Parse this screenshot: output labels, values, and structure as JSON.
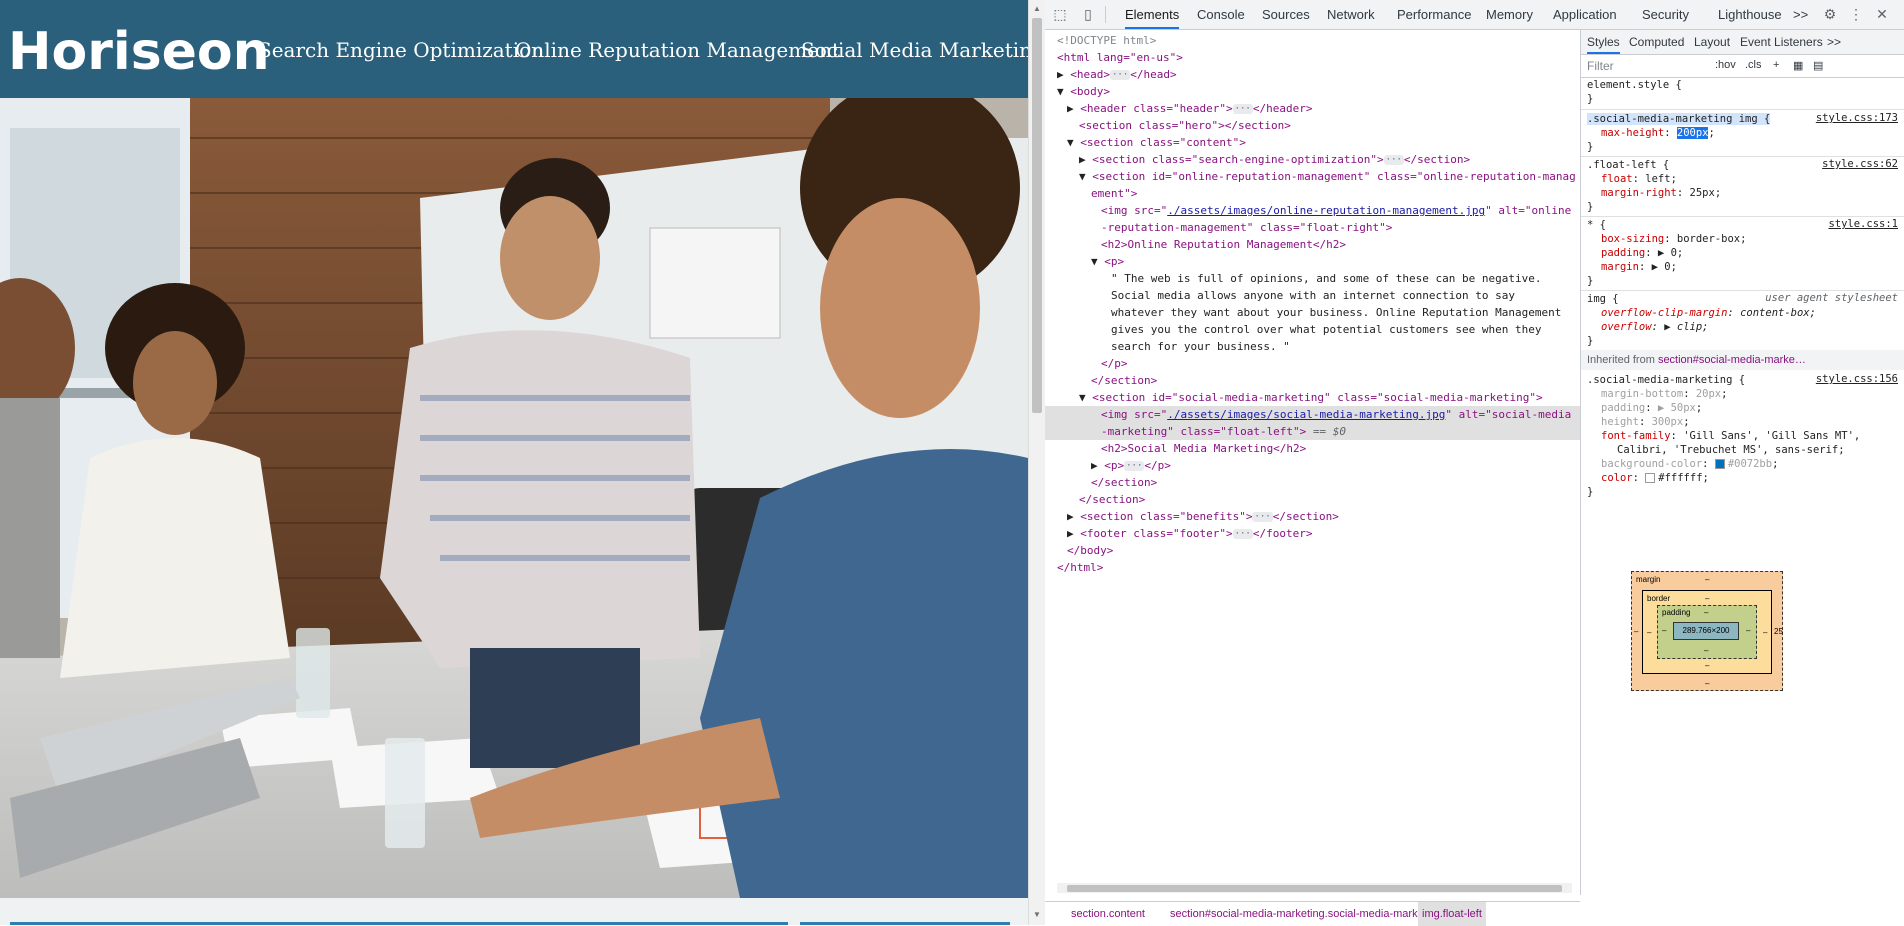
{
  "site": {
    "logo": "Horiseon",
    "nav": [
      "Search Engine Optimization",
      "Online Reputation Management",
      "Social Media Marketing"
    ]
  },
  "devtools": {
    "tabs": [
      "Elements",
      "Console",
      "Sources",
      "Network",
      "Performance",
      "Memory",
      "Application",
      "Security",
      "Lighthouse"
    ],
    "active_tab": "Elements",
    "more": ">>",
    "dom": {
      "doctype": "<!DOCTYPE html>",
      "html_open": "<html lang=\"en-us\">",
      "head": "<head>",
      "head_close": "</head>",
      "body_open": "<body>",
      "header": "<header class=\"header\">",
      "header_close": "</header>",
      "hero": "<section class=\"hero\"></section>",
      "content_open": "<section class=\"content\">",
      "seo": "<section class=\"search-engine-optimization\">",
      "section_close": "</section>",
      "orm_open_1": "<section id=\"online-reputation-management\" class=\"online-reputation-manag",
      "orm_open_2": "ement\">",
      "orm_img_tag": "<img src=\"",
      "orm_img_src": "./assets/images/online-reputation-management.jpg",
      "orm_img_alt_1": "\" alt=\"online",
      "orm_img_alt_2": "-reputation-management\" class=\"float-right\">",
      "orm_h2": "<h2>Online Reputation Management</h2>",
      "p_open": "<p>",
      "orm_text": [
        "\" The web is full of opinions, and some of these can be negative.",
        "Social media allows anyone with an internet connection to say",
        "whatever they want about your business. Online Reputation Management",
        "gives you the control over what potential customers see when they",
        "search for your business. \""
      ],
      "p_close": "</p>",
      "smm_open": "<section id=\"social-media-marketing\" class=\"social-media-marketing\">",
      "smm_img_tag": "<img src=\"",
      "smm_img_src": "./assets/images/social-media-marketing.jpg",
      "smm_img_alt_1": "\" alt=\"social-media",
      "smm_img_alt_2": "-marketing\" class=\"float-left\">",
      "smm_img_marker": "== $0",
      "smm_h2": "<h2>Social Media Marketing</h2>",
      "p_collapsed": "<p>",
      "p_collapsed_close": "</p>",
      "benefits": "<section class=\"benefits\">",
      "footer": "<footer class=\"footer\">",
      "footer_close": "</footer>",
      "body_close": "</body>",
      "html_close": "</html>",
      "dots": "···"
    },
    "breadcrumbs": [
      "section.content",
      "section#social-media-marketing.social-media-marketing",
      "img.float-left"
    ],
    "styles": {
      "sub_tabs": [
        "Styles",
        "Computed",
        "Layout",
        "Event Listeners",
        ">>"
      ],
      "filter_placeholder": "Filter",
      "hov": ":hov",
      "cls": ".cls",
      "plus": "+",
      "element_style": "element.style {",
      "close_brace": "}",
      "rule1_selector": ".social-media-marketing img {",
      "rule1_src": "style.css:173",
      "rule1_prop": "max-height",
      "rule1_val": "200px",
      "rule2_selector": ".float-left {",
      "rule2_src": "style.css:62",
      "rule2_props": [
        [
          "float",
          "left"
        ],
        [
          "margin-right",
          "25px"
        ]
      ],
      "rule3_selector": "* {",
      "rule3_src": "style.css:1",
      "rule3_props": [
        [
          "box-sizing",
          "border-box"
        ],
        [
          "padding",
          "▶ 0"
        ],
        [
          "margin",
          "▶ 0"
        ]
      ],
      "rule4_selector": "img {",
      "rule4_src": "user agent stylesheet",
      "rule4_props": [
        [
          "overflow-clip-margin",
          "content-box"
        ],
        [
          "overflow",
          "▶ clip"
        ]
      ],
      "inherited_label": "Inherited from",
      "inherited_from": "section#social-media-marke…",
      "rule5_selector": ".social-media-marketing {",
      "rule5_src": "style.css:156",
      "rule5_props": [
        [
          "margin-bottom",
          "20px"
        ],
        [
          "padding",
          "▶ 50px"
        ],
        [
          "height",
          "300px"
        ],
        [
          "font-family",
          "'Gill Sans', 'Gill Sans MT',"
        ],
        [
          "",
          "Calibri, 'Trebuchet MS', sans-serif"
        ],
        [
          "background-color",
          "#0072bb"
        ],
        [
          "color",
          "#ffffff"
        ]
      ],
      "bg_swatch": "#0072bb",
      "color_swatch": "#ffffff",
      "box": {
        "margin": "margin",
        "border": "border",
        "padding": "padding",
        "content": "289.766×200",
        "dash": "–",
        "right_margin": "25"
      }
    }
  },
  "colors": {
    "header_bg": "#2a607c",
    "accent": "#1a73e8"
  }
}
